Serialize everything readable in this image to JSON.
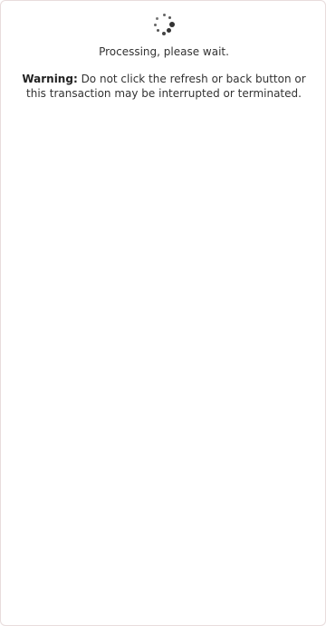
{
  "loader": {
    "icon": "loading-spinner-icon"
  },
  "status": {
    "processing_text": "Processing, please wait."
  },
  "warning": {
    "label": "Warning:",
    "message": " Do not click the refresh or back button or this transaction may be interrupted or terminated."
  }
}
